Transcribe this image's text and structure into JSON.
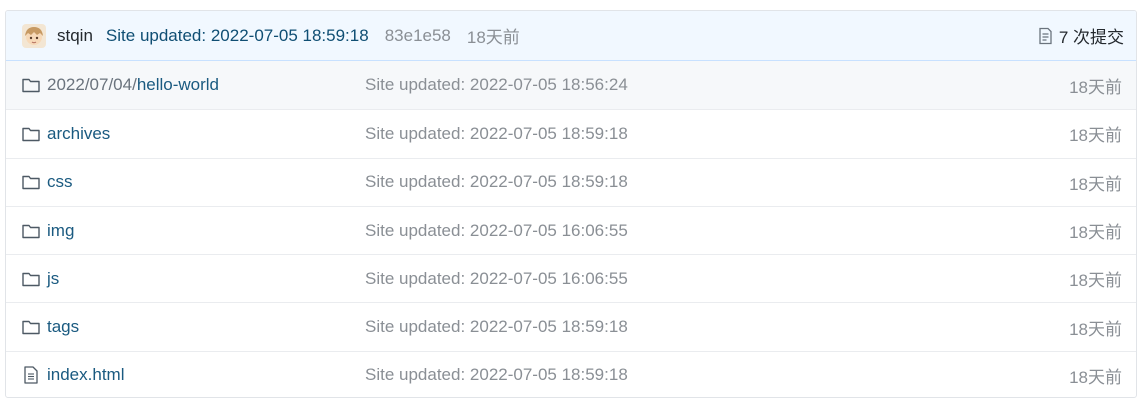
{
  "commit": {
    "author": "stqin",
    "message": "Site updated: 2022-07-05 18:59:18",
    "sha": "83e1e58",
    "age": "18天前",
    "commits_label": "7 次提交"
  },
  "files": [
    {
      "type": "folder",
      "prefix": "2022/07/04/",
      "name": "hello-world",
      "message": "Site updated: 2022-07-05 18:56:24",
      "age": "18天前"
    },
    {
      "type": "folder",
      "prefix": "",
      "name": "archives",
      "message": "Site updated: 2022-07-05 18:59:18",
      "age": "18天前"
    },
    {
      "type": "folder",
      "prefix": "",
      "name": "css",
      "message": "Site updated: 2022-07-05 18:59:18",
      "age": "18天前"
    },
    {
      "type": "folder",
      "prefix": "",
      "name": "img",
      "message": "Site updated: 2022-07-05 16:06:55",
      "age": "18天前"
    },
    {
      "type": "folder",
      "prefix": "",
      "name": "js",
      "message": "Site updated: 2022-07-05 16:06:55",
      "age": "18天前"
    },
    {
      "type": "folder",
      "prefix": "",
      "name": "tags",
      "message": "Site updated: 2022-07-05 18:59:18",
      "age": "18天前"
    },
    {
      "type": "file",
      "prefix": "",
      "name": "index.html",
      "message": "Site updated: 2022-07-05 18:59:18",
      "age": "18天前"
    }
  ],
  "icons": {
    "avatar": "avatar-icon",
    "commits": "history-book-icon",
    "folder": "folder-icon",
    "file": "file-icon"
  },
  "colors": {
    "link": "#1a5a80",
    "muted": "#8a8f95",
    "header_bg": "#f1f8ff"
  }
}
